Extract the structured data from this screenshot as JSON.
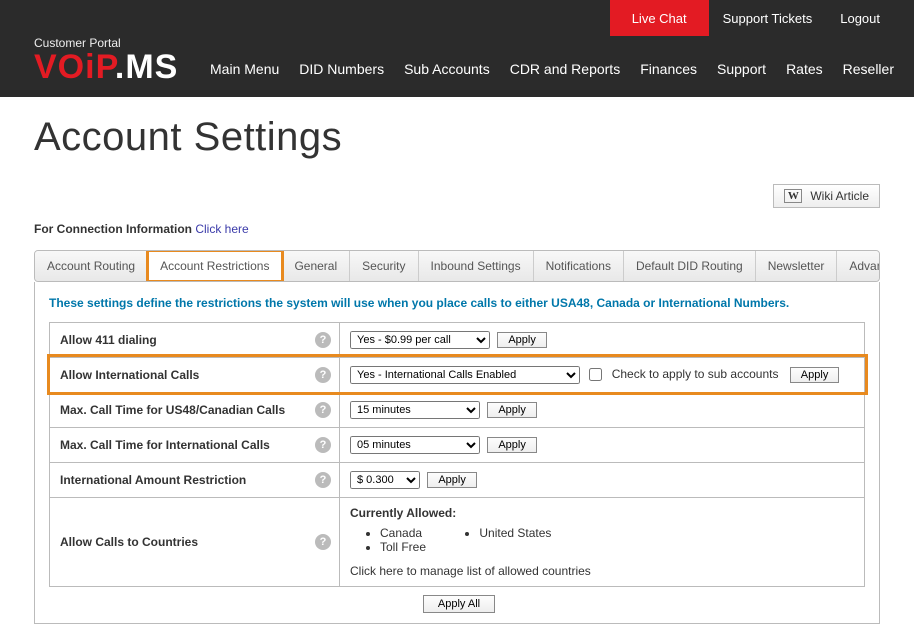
{
  "topbar": {
    "live_chat": "Live Chat",
    "support_tickets": "Support Tickets",
    "logout": "Logout"
  },
  "header": {
    "portal_label": "Customer Portal",
    "logo_main": "VOiP",
    "logo_suffix": ".MS"
  },
  "nav": {
    "main_menu": "Main Menu",
    "did_numbers": "DID Numbers",
    "sub_accounts": "Sub Accounts",
    "cdr_reports": "CDR and Reports",
    "finances": "Finances",
    "support": "Support",
    "rates": "Rates",
    "reseller": "Reseller"
  },
  "page": {
    "title": "Account Settings",
    "wiki_button": "Wiki Article",
    "conn_info_prefix": "For Connection Information ",
    "conn_info_link": "Click here"
  },
  "tabs": {
    "account_routing": "Account Routing",
    "account_restrictions": "Account Restrictions",
    "general": "General",
    "security": "Security",
    "inbound_settings": "Inbound Settings",
    "notifications": "Notifications",
    "default_did_routing": "Default DID Routing",
    "newsletter": "Newsletter",
    "advanced": "Advanced"
  },
  "panel": {
    "description": "These settings define the restrictions the system will use when you place calls to either USA48, Canada or International Numbers.",
    "apply_label": "Apply",
    "apply_all_label": "Apply All",
    "rows": {
      "allow_411": {
        "label": "Allow 411 dialing",
        "value": "Yes - $0.99 per call"
      },
      "allow_intl": {
        "label": "Allow International Calls",
        "value": "Yes - International Calls Enabled",
        "sub_check_label": "Check to apply to sub accounts"
      },
      "max_us48": {
        "label": "Max. Call Time for US48/Canadian Calls",
        "value": "15 minutes"
      },
      "max_intl": {
        "label": "Max. Call Time for International Calls",
        "value": "05 minutes"
      },
      "intl_amount": {
        "label": "International Amount Restriction",
        "value": "$ 0.300"
      },
      "allow_countries": {
        "label": "Allow Calls to Countries",
        "currently_allowed": "Currently Allowed:",
        "col1_a": "Canada",
        "col1_b": "Toll Free",
        "col2_a": "United States",
        "manage_text": "Click here to manage list of allowed countries"
      }
    }
  }
}
